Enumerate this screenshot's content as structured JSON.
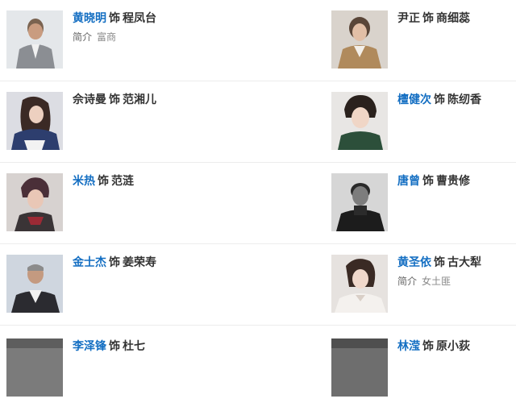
{
  "separator": "饰",
  "intro_label": "简介",
  "colors": {
    "link": "#136ec2",
    "text": "#333333",
    "muted": "#888888",
    "divider": "#ececec"
  },
  "cast": [
    {
      "actor": "黄晓明",
      "role": "程凤台",
      "actor_is_link": true,
      "intro": "富商",
      "photo": "photo-icon"
    },
    {
      "actor": "尹正",
      "role": "商细蕊",
      "actor_is_link": false,
      "intro": "",
      "photo": "photo-icon"
    },
    {
      "actor": "佘诗曼",
      "role": "范湘儿",
      "actor_is_link": false,
      "intro": "",
      "photo": "photo-icon"
    },
    {
      "actor": "檀健次",
      "role": "陈纫香",
      "actor_is_link": true,
      "intro": "",
      "photo": "photo-icon"
    },
    {
      "actor": "米热",
      "role": "范涟",
      "actor_is_link": true,
      "intro": "",
      "photo": "photo-icon"
    },
    {
      "actor": "唐曾",
      "role": "曹贵修",
      "actor_is_link": true,
      "intro": "",
      "photo": "photo-icon"
    },
    {
      "actor": "金士杰",
      "role": "姜荣寿",
      "actor_is_link": true,
      "intro": "",
      "photo": "photo-icon"
    },
    {
      "actor": "黄圣依",
      "role": "古大犁",
      "actor_is_link": true,
      "intro": "女土匪",
      "photo": "photo-icon"
    },
    {
      "actor": "李泽锋",
      "role": "杜七",
      "actor_is_link": true,
      "intro": "",
      "photo": "photo-icon"
    },
    {
      "actor": "林滢",
      "role": "原小荻",
      "actor_is_link": true,
      "intro": "",
      "photo": "photo-icon"
    }
  ]
}
